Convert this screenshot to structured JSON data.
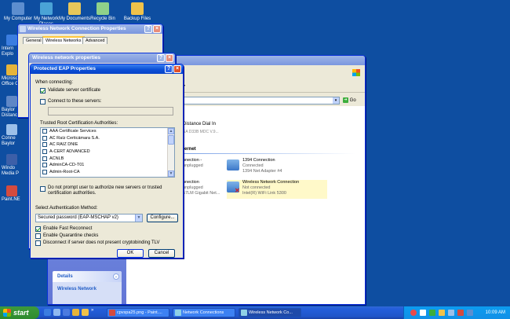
{
  "desktop": {
    "top_icons": [
      {
        "label": "My Computer",
        "icon": "computer-icon",
        "color": "#5d8ecf"
      },
      {
        "label": "My Network Places",
        "icon": "network-places-icon",
        "color": "#4aa3d6"
      },
      {
        "label": "My Documents",
        "icon": "documents-icon",
        "color": "#e8c75a"
      },
      {
        "label": "Recycle Bin",
        "icon": "recycle-bin-icon",
        "color": "#8fd18a"
      },
      {
        "label": "Backup Files",
        "icon": "folder-icon",
        "color": "#f0c24a"
      }
    ],
    "left_icons": [
      {
        "label": "Intern Explo",
        "icon": "ie-icon",
        "color": "#3b7de0"
      },
      {
        "label": "Microsoft Office Ou",
        "icon": "outlook-icon",
        "color": "#e6b43a"
      },
      {
        "label": "Baylor Distanc",
        "icon": "shortcut-icon",
        "color": "#5f87c6"
      },
      {
        "label": "Conne Baylor",
        "icon": "connect-icon",
        "color": "#9cc0e9"
      },
      {
        "label": "Windo Media P",
        "icon": "media-player-icon",
        "color": "#3c5fa8"
      },
      {
        "label": "Paint.NE",
        "icon": "paint-icon",
        "color": "#d44b3f"
      }
    ]
  },
  "wnc_props": {
    "title": "Wireless Network Connection Properties",
    "tabs": [
      "General",
      "Wireless Networks",
      "Advanced"
    ]
  },
  "wn_props": {
    "title": "Wireless network properties"
  },
  "net_connections": {
    "address_go": "Go",
    "group_broadband": "Distance Dial In",
    "broadband_sub": "SA D33B MDC V.9...",
    "group_lan": "ternet",
    "items": [
      {
        "name": "1394 Connection",
        "status": "Connected",
        "device": "1394 Net Adapter #4"
      },
      {
        "name": "Wireless Network Connection",
        "status": "Not connected",
        "device": "Intel(R) WiFi Link 5300"
      }
    ],
    "partial_items": [
      {
        "name": "nnection -",
        "status": "unplugged"
      },
      {
        "name": "nnection",
        "status": "unplugged",
        "device": "57LM Gigabit Net..."
      }
    ],
    "sidebar_details": "Details",
    "sidebar_wireless": "Wireless Network"
  },
  "eap": {
    "title": "Protected EAP Properties",
    "when_connecting": "When connecting:",
    "validate_cert": "Validate server certificate",
    "connect_servers": "Connect to these servers:",
    "trusted_roots_label": "Trusted Root Certification Authorities:",
    "trusted_roots": [
      "AAA Certificate Services",
      "AC Raíz Certicámara S.A.",
      "AC RAIZ DNIE",
      "A-CERT ADVANCED",
      "ACNLB",
      "AdminCA-CD-T01",
      "Admin-Root-CA"
    ],
    "no_prompt": "Do not prompt user to authorize new servers or trusted certification authorities.",
    "auth_method_label": "Select Authentication Method:",
    "auth_method_value": "Secured password (EAP-MSCHAP v2)",
    "configure": "Configure...",
    "fast_reconnect": "Enable Fast Reconnect",
    "quarantine": "Enable Quarantine checks",
    "disconnect_tlv": "Disconnect if server does not present cryptobinding TLV",
    "ok": "OK",
    "cancel": "Cancel"
  },
  "taskbar": {
    "start": "start",
    "tasks": [
      {
        "label": "cpvspa25.png - Paint....",
        "icon": "paint-icon",
        "active": false
      },
      {
        "label": "Network Connections",
        "icon": "network-icon",
        "active": false
      },
      {
        "label": "Wireless Network Co...",
        "icon": "network-icon",
        "active": true
      }
    ],
    "clock": "10:09 AM"
  }
}
